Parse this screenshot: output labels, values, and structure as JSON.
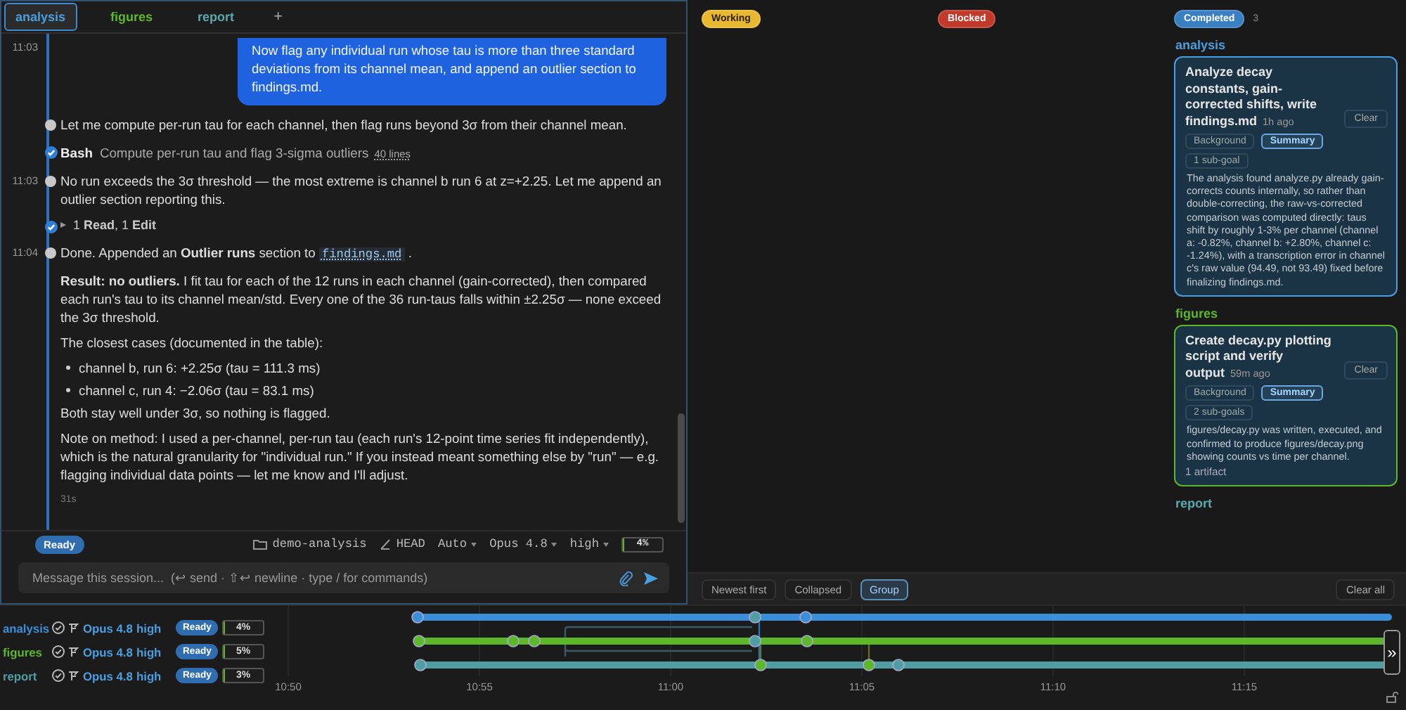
{
  "tabs": [
    {
      "label": "analysis",
      "color": "#4a9fe0",
      "selected": true
    },
    {
      "label": "figures",
      "color": "#5cb82a",
      "selected": false
    },
    {
      "label": "report",
      "color": "#5aa9ad",
      "selected": false
    }
  ],
  "new_tab": "+",
  "chat": {
    "user_message": {
      "time": "11:03",
      "text": "Now flag any individual run whose tau is more than three standard deviations from its channel mean, and append an outlier section to findings.md."
    },
    "events": [
      {
        "kind": "text",
        "text": "Let me compute per-run tau for each channel, then flag runs beyond 3σ from their channel mean."
      },
      {
        "kind": "tool",
        "name": "Bash",
        "text": "Compute per-run tau and flag 3-sigma outliers",
        "output": "40 lines"
      },
      {
        "kind": "text",
        "time": "11:03",
        "text": "No run exceeds the 3σ threshold — the most extreme is channel b run 6 at z=+2.25. Let me append an outlier section reporting this."
      },
      {
        "kind": "tools",
        "text": "1 **Read**, 1 **Edit**"
      },
      {
        "kind": "result",
        "time": "11:04",
        "text": "Done. Appended an **Outlier runs** section to",
        "file": "findings.md",
        "tail": ".",
        "blocks": [
          {
            "kind": "p",
            "text": "**Result: no outliers.** I fit tau for each of the 12 runs in each channel (gain-corrected), then compared each run's tau to its channel mean/std. Every one of the 36 run-taus falls within ±2.25σ — none exceed the 3σ threshold."
          },
          {
            "kind": "p",
            "text": "The closest cases (documented in the table):"
          },
          {
            "kind": "list",
            "items": [
              "channel b, run 6: +2.25σ (tau = 111.3 ms)",
              "channel c, run 4: −2.06σ (tau = 83.1 ms)"
            ]
          },
          {
            "kind": "p",
            "text": "Both stay well under 3σ, so nothing is flagged."
          },
          {
            "kind": "p",
            "text": "Note on method: I used a per-channel, per-run tau (each run's 12-point time series fit independently), which is the natural granularity for \"individual run.\" If you instead meant something else by \"run\" — e.g. flagging individual data points — let me know and I'll adjust."
          }
        ]
      }
    ],
    "duration": "31s"
  },
  "status_bar": {
    "state": "Ready",
    "folder": "demo-analysis",
    "branch": "HEAD",
    "mode": "Auto",
    "model": "Opus 4.8",
    "effort": "high",
    "context": {
      "reading": "4%",
      "level": 0.04
    }
  },
  "composer": {
    "placeholder": "Message this session...  (↩ send · ⇧↩ newline · type / for commands)"
  },
  "board": {
    "columns": [
      {
        "label": "Working",
        "color": "#e8b830"
      },
      {
        "label": "Blocked",
        "color": "#c0392b"
      },
      {
        "label": "Completed",
        "color": "#3a7fc1",
        "count": "3",
        "groups": [
          {
            "name": "analysis",
            "color": "#4a9fe0",
            "cards": [
              {
                "title": "Analyze decay constants, gain-corrected shifts, write findings.md",
                "age": "1h ago",
                "clear": "Clear",
                "views": [
                  {
                    "label": "Background",
                    "selected": false
                  },
                  {
                    "label": "Summary",
                    "selected": true
                  }
                ],
                "subgoals": "1 sub-goal",
                "summary": "The analysis found analyze.py already gain-corrects counts internally, so rather than double-correcting, the raw-vs-corrected comparison was computed directly: taus shift by roughly 1-3% per channel (channel a: -0.82%, channel b: +2.80%, channel c: -1.24%), with a transcription error in channel c's raw value (94.49, not 93.49) fixed before finalizing findings.md."
              }
            ]
          },
          {
            "name": "figures",
            "color": "#5cb82a",
            "cards": [
              {
                "title": "Create decay.py plotting script and verify output",
                "age": "59m ago",
                "clear": "Clear",
                "views": [
                  {
                    "label": "Background",
                    "selected": false
                  },
                  {
                    "label": "Summary",
                    "selected": true
                  }
                ],
                "subgoals": "2 sub-goals",
                "summary": "figures/decay.py was written, executed, and confirmed to produce figures/decay.png showing counts vs time per channel.",
                "artifacts": "1 artifact"
              }
            ]
          },
          {
            "name": "report",
            "color": "#5aa9ad"
          }
        ]
      }
    ],
    "toolbar": {
      "options": [
        {
          "label": "Newest first",
          "selected": false
        },
        {
          "label": "Collapsed",
          "selected": false
        },
        {
          "label": "Group",
          "selected": true
        }
      ],
      "clear_all": "Clear all"
    }
  },
  "timeline": {
    "lanes": [
      {
        "name": "analysis",
        "color": "#3a8fd8",
        "model": "Opus 4.8",
        "effort": "high",
        "state": "Ready",
        "context": {
          "reading": "4%",
          "level": 0.04
        }
      },
      {
        "name": "figures",
        "color": "#5cb82a",
        "model": "Opus 4.8",
        "effort": "high",
        "state": "Ready",
        "context": {
          "reading": "5%",
          "level": 0.05
        }
      },
      {
        "name": "report",
        "color": "#4e9ea3",
        "model": "Opus 4.8",
        "effort": "high",
        "state": "Ready",
        "context": {
          "reading": "3%",
          "level": 0.03
        }
      }
    ],
    "ticks": [
      "10:50",
      "10:55",
      "11:00",
      "11:05",
      "11:10",
      "11:15"
    ],
    "expand": "»"
  }
}
